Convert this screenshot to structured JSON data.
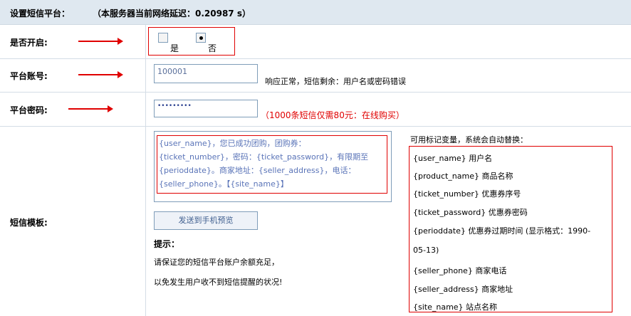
{
  "header": {
    "title": "设置短信平台：",
    "latency": "（本服务器当前网络延迟：0.20987 s）"
  },
  "rows": {
    "enable": {
      "label": "是否开启:",
      "options": [
        {
          "label": "是",
          "checked": false
        },
        {
          "label": "否",
          "checked": true
        }
      ]
    },
    "account": {
      "label": "平台账号:",
      "value": "100001",
      "status": "响应正常，短信剩余：用户名或密码错误"
    },
    "password": {
      "label": "平台密码:",
      "value": "•••••••••",
      "promo_open": "（",
      "promo": "1000条短信仅需80元：在线购买",
      "promo_close": "）"
    },
    "template": {
      "label": "短信模板:",
      "content_lines": [
        "{user_name}，您已成功团购，团购券：",
        "{ticket_number}，密码：{ticket_password}，有限期至",
        "{perioddate}。商家地址：{seller_address}，电话：",
        "{seller_phone}。【{site_name}】"
      ],
      "preview_button": "发送到手机预览",
      "tip_title": "提示：",
      "tip_lines": [
        "请保证您的短信平台账户余额充足，",
        "以免发生用户收不到短信提醒的状况!"
      ],
      "vars_title": "可用标记变量，系统会自动替换：",
      "vars": [
        "{user_name} 用户名",
        "{product_name} 商品名称",
        "{ticket_number} 优惠券序号",
        "{ticket_password} 优惠券密码",
        "{perioddate} 优惠券过期时间 (显示格式：1990-",
        "05-13)",
        "{seller_phone} 商家电话",
        "{seller_address} 商家地址",
        "{site_name} 站点名称"
      ]
    }
  },
  "colors": {
    "header_bg": "#dfe8f0",
    "annotation_red": "#e00000",
    "template_text": "#5a74b8"
  }
}
